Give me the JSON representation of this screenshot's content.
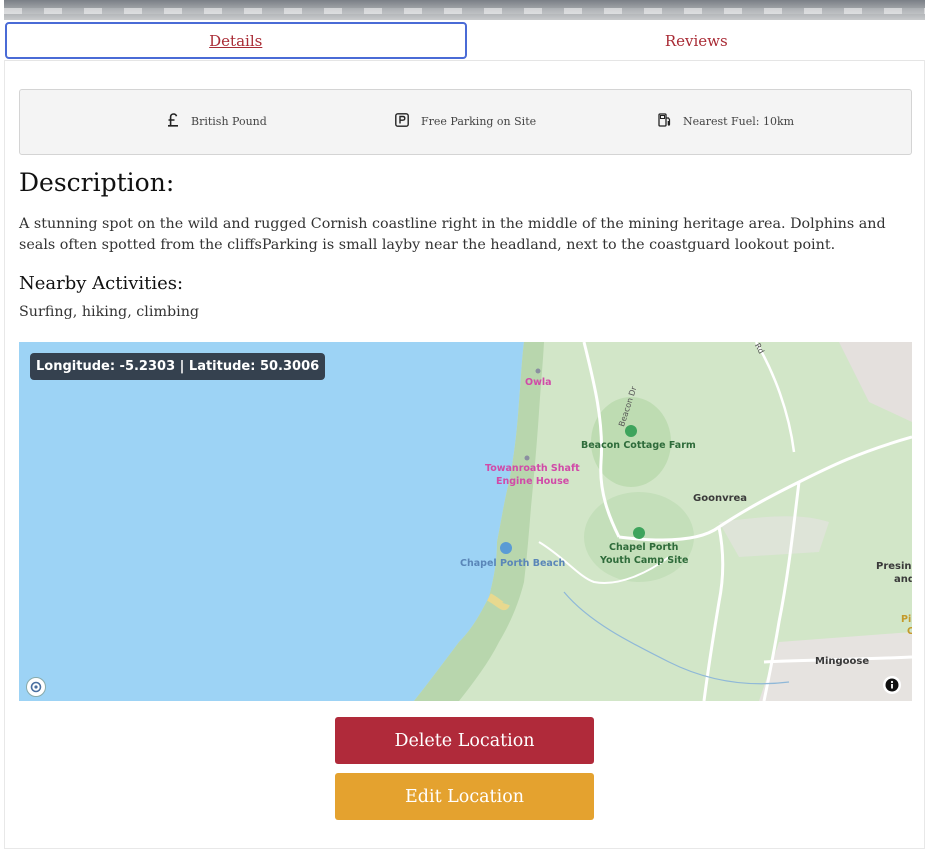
{
  "tabs": [
    {
      "label": "Details",
      "active": true
    },
    {
      "label": "Reviews",
      "active": false
    }
  ],
  "info": {
    "currency": {
      "icon": "pound-icon",
      "label": "British Pound"
    },
    "parking": {
      "icon": "parking-icon",
      "label": "Free Parking on Site"
    },
    "fuel": {
      "icon": "fuel-pump-icon",
      "label": "Nearest Fuel: 10km"
    }
  },
  "description": {
    "title": "Description:",
    "text": "A stunning spot on the wild and rugged Cornish coastline right in the middle of the mining heritage area. Dolphins and seals often spotted from the cliffsParking is small layby near the headland, next to the coastguard lookout point."
  },
  "activities": {
    "title": "Nearby Activities:",
    "text": "Surfing, hiking, climbing"
  },
  "map": {
    "coords": "Longitude: -5.2303 | Latitude: 50.3006",
    "labels": {
      "owla": "Owla",
      "beacon_dr": "Beacon Dr",
      "rd": "Rd",
      "beacon_cottage_farm": "Beacon Cottage Farm",
      "towanroath_1": "Towanroath Shaft",
      "towanroath_2": "Engine House",
      "goonvrea": "Goonvrea",
      "chapel_porth_camp_1": "Chapel Porth",
      "chapel_porth_camp_2": "Youth Camp Site",
      "chapel_porth_beach": "Chapel Porth Beach",
      "presing_1": "Presing",
      "presing_2": "and",
      "pi_1": "Pi",
      "pi_2": "C",
      "mingoose": "Mingoose"
    },
    "colors": {
      "sea": "#9dd3f5",
      "land": "#cfe3c6",
      "road": "#ffffff"
    }
  },
  "actions": {
    "delete_label": "Delete Location",
    "edit_label": "Edit Location",
    "delete_color": "#b02a3a",
    "edit_color": "#e4a22f"
  }
}
